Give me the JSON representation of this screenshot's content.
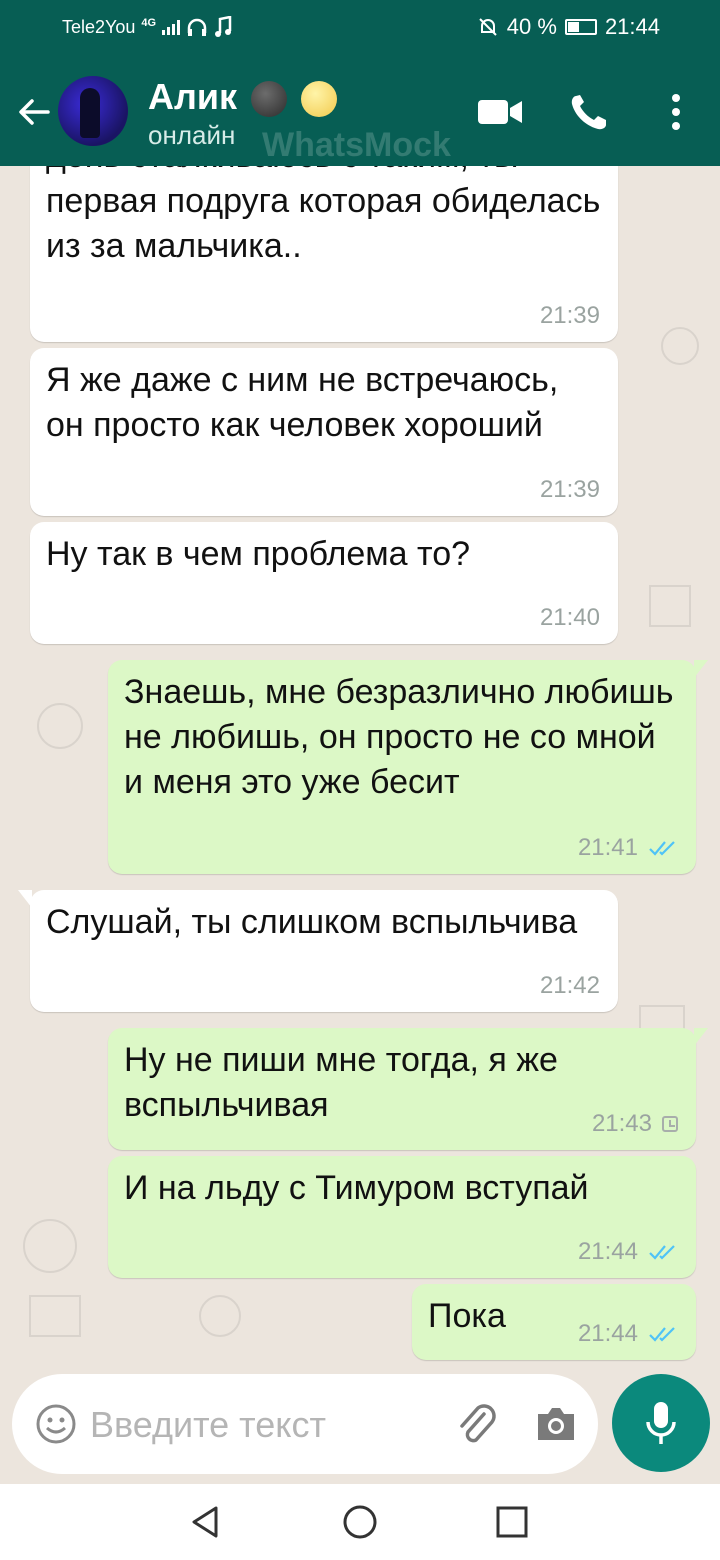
{
  "status_bar": {
    "carrier": "Tele2You",
    "network_type": "4G",
    "battery": "40 %",
    "time": "21:44"
  },
  "header": {
    "contact_name": "Алик",
    "presence": "онлайн",
    "watermark": "WhatsMock",
    "icons": [
      "back-arrow-icon",
      "avatar",
      "new-moon-emoji",
      "full-moon-face-emoji",
      "video-call-icon",
      "phone-icon",
      "more-options-icon"
    ]
  },
  "messages": [
    {
      "direction": "in",
      "text": "день сталкиваюсь с таким, ты первая подруга которая обиделась из за мальчика..",
      "time": "21:39"
    },
    {
      "direction": "in",
      "text": "Я же даже с ним не встречаюсь, он просто как человек хороший",
      "time": "21:39"
    },
    {
      "direction": "in",
      "text": "Ну так в чем проблема то?",
      "time": "21:40"
    },
    {
      "direction": "out",
      "text": "Знаешь, мне безразлично любишь не любишь, он просто не со мной и меня это уже бесит",
      "time": "21:41",
      "status": "read"
    },
    {
      "direction": "in",
      "text": "Слушай, ты слишком вспыльчива",
      "time": "21:42"
    },
    {
      "direction": "out",
      "text": "Ну не пиши мне тогда, я же вспыльчивая",
      "time": "21:43",
      "status": "pending"
    },
    {
      "direction": "out",
      "text": "И на льду с Тимуром вступай",
      "time": "21:44",
      "status": "read"
    },
    {
      "direction": "out",
      "text": "Пока",
      "time": "21:44",
      "status": "read"
    }
  ],
  "composer": {
    "placeholder": "Введите текст",
    "icons": [
      "emoji-icon",
      "attach-icon",
      "camera-icon",
      "mic-icon"
    ]
  },
  "colors": {
    "header": "#075e54",
    "outgoing_bubble": "#dcf8c6",
    "incoming_bubble": "#ffffff",
    "chat_background": "#ece5dd",
    "read_ticks": "#4fc3f7",
    "mic_button": "#0b897c"
  }
}
